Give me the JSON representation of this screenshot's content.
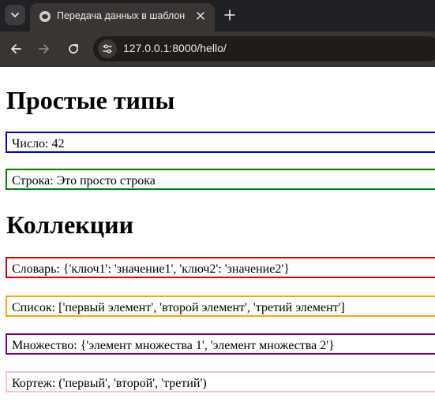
{
  "browser": {
    "tab_title": "Передача данных в шаблон",
    "url": "127.0.0.1:8000/hello/"
  },
  "page": {
    "simple_heading": "Простые типы",
    "collections_heading": "Коллекции",
    "items": [
      {
        "label": "Число:",
        "value": "42",
        "color": "#0000cc"
      },
      {
        "label": "Строка:",
        "value": "Это просто строка",
        "color": "#008000"
      },
      {
        "label": "Словарь:",
        "value": "{'ключ1': 'значение1', 'ключ2': 'значение2'}",
        "color": "#dd0000"
      },
      {
        "label": "Список:",
        "value": "['первый элемент', 'второй элемент', 'третий элемент']",
        "color": "#ffa500"
      },
      {
        "label": "Множество:",
        "value": "{'элемент множества 1', 'элемент множества 2'}",
        "color": "#800080"
      },
      {
        "label": "Кортеж:",
        "value": "('первый', 'второй', 'третий')",
        "color": "#ffc0cb"
      }
    ]
  }
}
